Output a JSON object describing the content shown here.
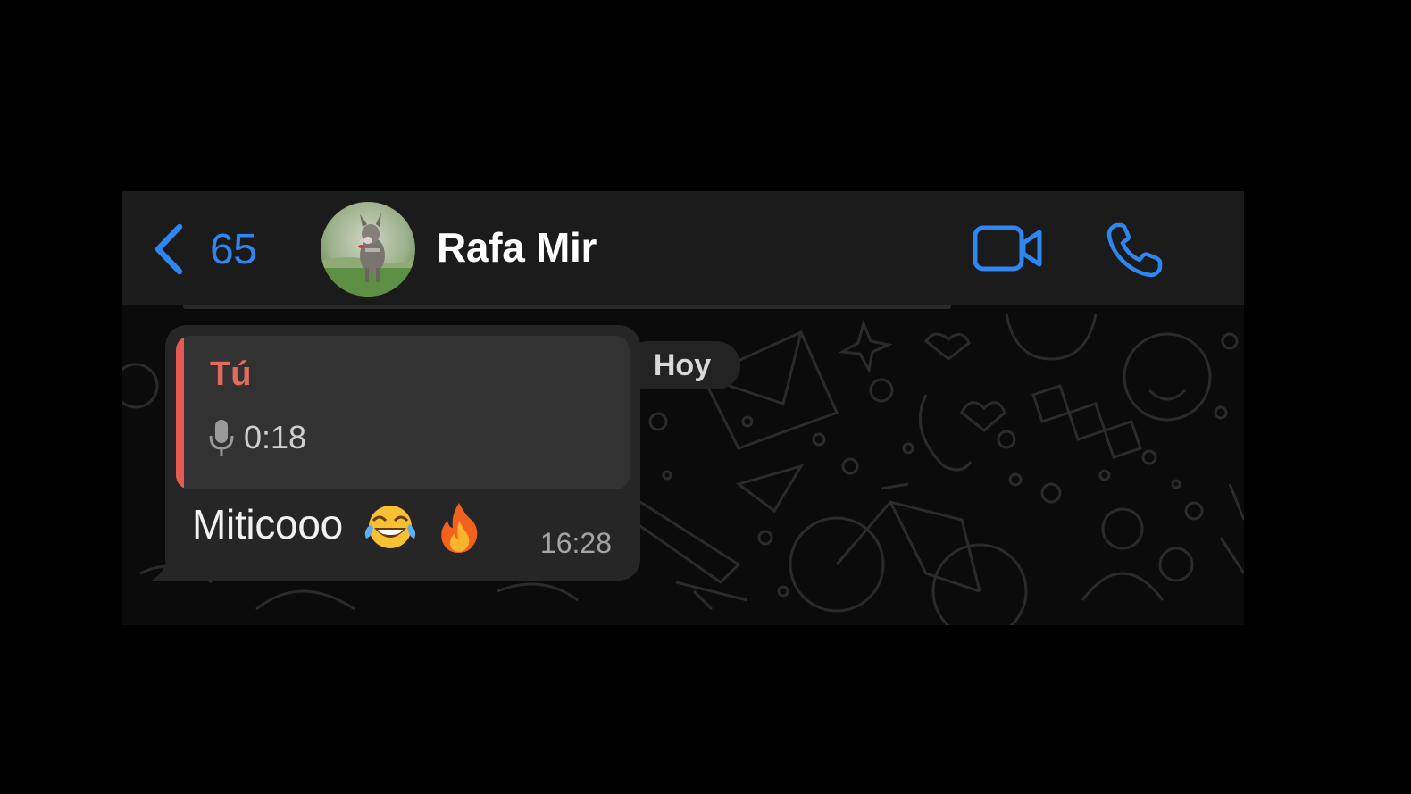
{
  "header": {
    "back_count": "65",
    "contact_name": "Rafa Mir",
    "video_icon": "video-camera-icon",
    "call_icon": "phone-icon",
    "accent_color": "#2f86f0"
  },
  "chat": {
    "date_label": "Hoy",
    "message": {
      "quoted_author": "Tú",
      "quoted_voice_duration": "0:18",
      "quoted_accent_color": "#e55b52",
      "text": "Miticooo",
      "emojis": [
        "face-with-tears-of-joy-icon",
        "fire-icon"
      ],
      "time": "16:28"
    }
  }
}
